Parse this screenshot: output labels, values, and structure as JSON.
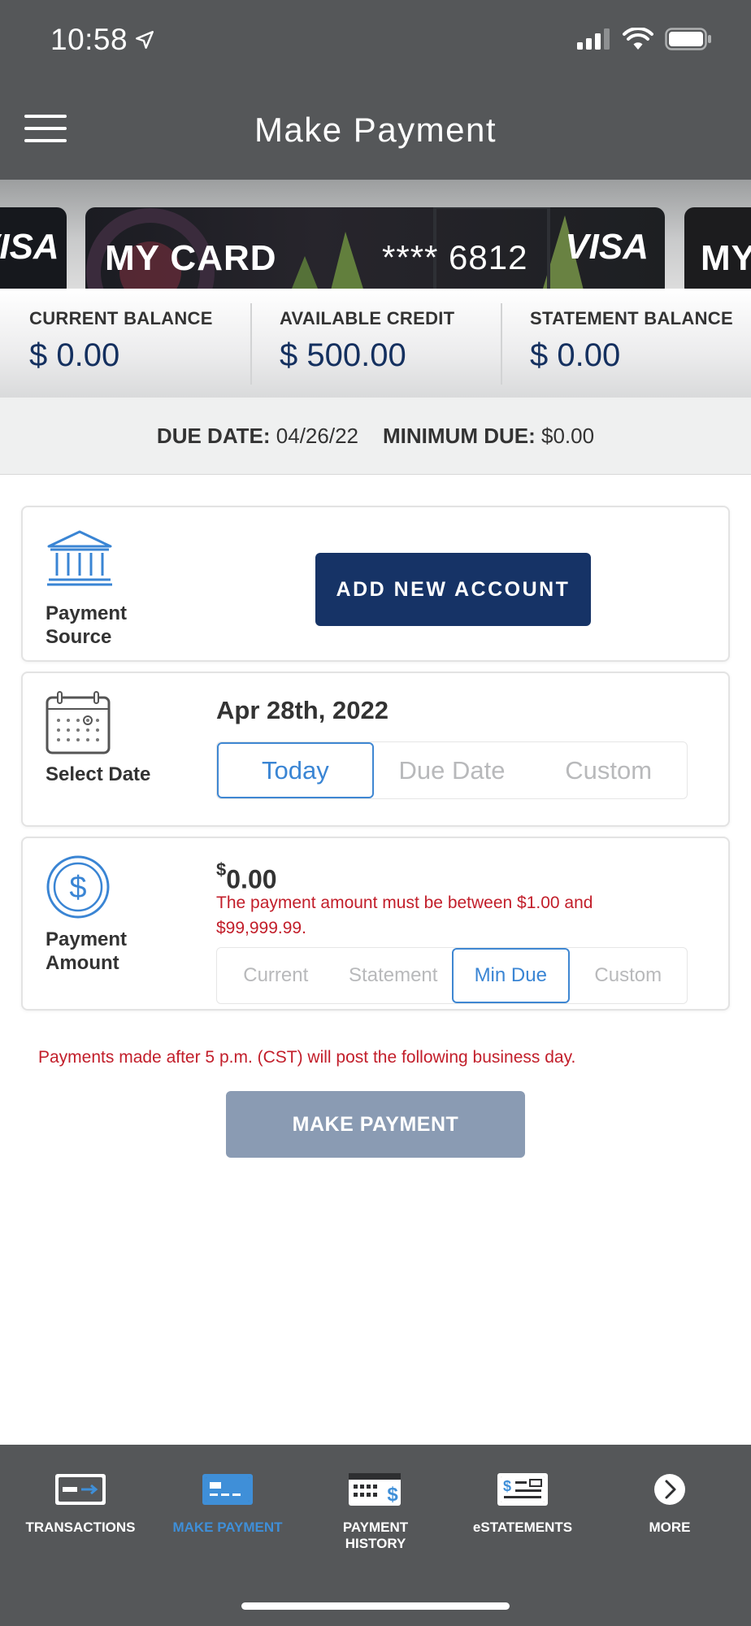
{
  "status_bar": {
    "time": "10:58"
  },
  "header": {
    "title": "Make Payment"
  },
  "cards": {
    "left": {
      "brand": "VISA"
    },
    "main": {
      "name": "MY CARD",
      "number": "**** 6812",
      "brand": "VISA"
    },
    "right": {
      "name": "MY"
    }
  },
  "balances": [
    {
      "label": "CURRENT BALANCE",
      "value": "$ 0.00"
    },
    {
      "label": "AVAILABLE CREDIT",
      "value": "$ 500.00"
    },
    {
      "label": "STATEMENT BALANCE",
      "value": "$ 0.00"
    }
  ],
  "due": {
    "due_date_label": "DUE DATE:",
    "due_date_value": "04/26/22",
    "minimum_due_label": "MINIMUM DUE:",
    "minimum_due_value": "$0.00"
  },
  "payment_source": {
    "label_line1": "Payment",
    "label_line2": "Source",
    "add_button": "ADD NEW ACCOUNT"
  },
  "select_date": {
    "label": "Select Date",
    "value": "Apr 28th, 2022",
    "options": [
      "Today",
      "Due Date",
      "Custom"
    ],
    "selected": "Today"
  },
  "payment_amount": {
    "label_line1": "Payment",
    "label_line2": "Amount",
    "currency_symbol": "$",
    "value": "0.00",
    "error": "The payment amount must be between $1.00 and $99,999.99.",
    "options": [
      "Current",
      "Statement",
      "Min Due",
      "Custom"
    ],
    "selected": "Min Due"
  },
  "notice": "Payments made after 5 p.m. (CST) will post the following business day.",
  "make_payment_button": "MAKE PAYMENT",
  "bottom_nav": [
    {
      "label": "TRANSACTIONS",
      "icon": "transactions-icon"
    },
    {
      "label": "MAKE PAYMENT",
      "icon": "make-payment-icon",
      "active": true
    },
    {
      "label_line1": "PAYMENT",
      "label_line2": "HISTORY",
      "icon": "payment-history-icon"
    },
    {
      "label": "eSTATEMENTS",
      "icon": "estatements-icon"
    },
    {
      "label": "MORE",
      "icon": "more-icon"
    }
  ],
  "colors": {
    "header_bg": "#555759",
    "navy": "#163366",
    "accent_blue": "#3a85d4",
    "error_red": "#c21e2a",
    "disabled_button": "#8a9bb3"
  }
}
